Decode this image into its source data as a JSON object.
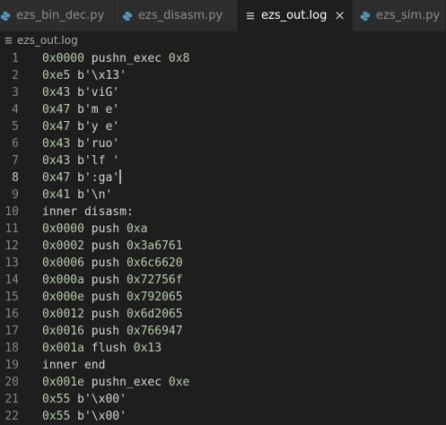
{
  "tabs": [
    {
      "label": "ezs_bin_dec.py",
      "icon": "python-icon",
      "active": false
    },
    {
      "label": "ezs_disasm.py",
      "icon": "python-icon",
      "active": false
    },
    {
      "label": "ezs_out.log",
      "icon": "log-file-icon",
      "active": true,
      "close": "×"
    },
    {
      "label": "ezs_sim.py",
      "icon": "python-icon",
      "active": false
    }
  ],
  "breadcrumb": {
    "file": "ezs_out.log"
  },
  "colors": {
    "editor_bg": "#1e1e1e",
    "tab_inactive_bg": "#2d2d2d",
    "number": "#b5cea8",
    "text": "#d4d4d4",
    "python_icon": "#519aba"
  },
  "editor": {
    "current_line": 8,
    "lines": [
      {
        "n": "1",
        "addr": "0x0000",
        "text": " pushn_exec ",
        "num": "0x8"
      },
      {
        "n": "2",
        "addr": "0xe5",
        "text": " b'\\x13'",
        "num": ""
      },
      {
        "n": "3",
        "addr": "0x43",
        "text": " b'viG'",
        "num": ""
      },
      {
        "n": "4",
        "addr": "0x47",
        "text": " b'm e'",
        "num": ""
      },
      {
        "n": "5",
        "addr": "0x47",
        "text": " b'y e'",
        "num": ""
      },
      {
        "n": "6",
        "addr": "0x43",
        "text": " b'ruo'",
        "num": ""
      },
      {
        "n": "7",
        "addr": "0x43",
        "text": " b'lf '",
        "num": ""
      },
      {
        "n": "8",
        "addr": "0x47",
        "text": " b':ga'",
        "num": ""
      },
      {
        "n": "9",
        "addr": "0x41",
        "text": " b'\\n'",
        "num": ""
      },
      {
        "n": "10",
        "addr": "",
        "text": "inner disasm:",
        "num": ""
      },
      {
        "n": "11",
        "addr": "0x0000",
        "text": " push ",
        "num": "0xa"
      },
      {
        "n": "12",
        "addr": "0x0002",
        "text": " push ",
        "num": "0x3a6761"
      },
      {
        "n": "13",
        "addr": "0x0006",
        "text": " push ",
        "num": "0x6c6620"
      },
      {
        "n": "14",
        "addr": "0x000a",
        "text": " push ",
        "num": "0x72756f"
      },
      {
        "n": "15",
        "addr": "0x000e",
        "text": " push ",
        "num": "0x792065"
      },
      {
        "n": "16",
        "addr": "0x0012",
        "text": " push ",
        "num": "0x6d2065"
      },
      {
        "n": "17",
        "addr": "0x0016",
        "text": " push ",
        "num": "0x766947"
      },
      {
        "n": "18",
        "addr": "0x001a",
        "text": " flush ",
        "num": "0x13"
      },
      {
        "n": "19",
        "addr": "",
        "text": "inner end",
        "num": ""
      },
      {
        "n": "20",
        "addr": "0x001e",
        "text": " pushn_exec ",
        "num": "0xe"
      },
      {
        "n": "21",
        "addr": "0x55",
        "text": " b'\\x00'",
        "num": ""
      },
      {
        "n": "22",
        "addr": "0x55",
        "text": " b'\\x00'",
        "num": ""
      }
    ]
  }
}
